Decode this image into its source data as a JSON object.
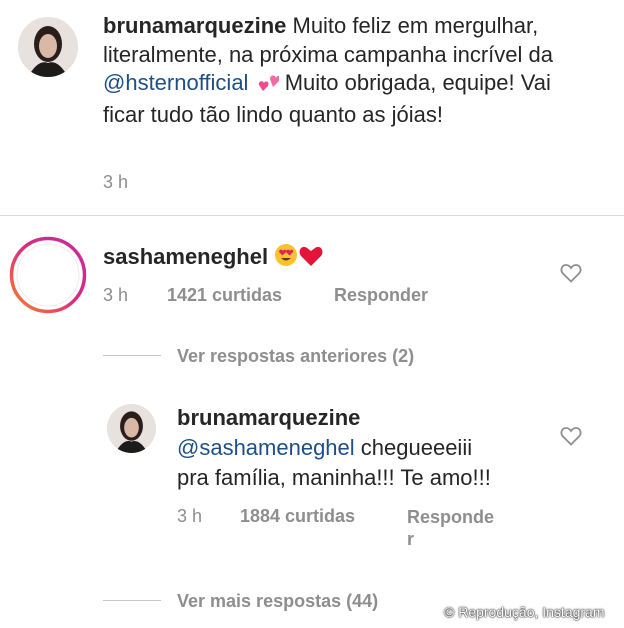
{
  "post": {
    "username": "brunamarquezine",
    "caption_text_1": " Muito feliz em mergulhar, literalmente, na próxima campanha incrível da ",
    "mention": "@hsternofficial",
    "caption_text_2": " Muito obrigada, equipe! Vai ficar tudo tão lindo quanto as jóias!",
    "time": "3 h"
  },
  "comment": {
    "username": "sashameneghel",
    "time": "3 h",
    "likes": "1421 curtidas",
    "reply_label": "Responder",
    "view_previous": "Ver respostas anteriores (2)"
  },
  "reply": {
    "username": "brunamarquezine",
    "mention": "@sashameneghel",
    "text_1": " chegueeeiii",
    "text_2": "pra família, maninha!!! Te amo!!!",
    "time": "3 h",
    "likes": "1884 curtidas",
    "reply_label_1": "Responde",
    "reply_label_2": "r"
  },
  "more_replies": "Ver mais respostas (44)",
  "credit": "© Reprodução, Instagram",
  "colors": {
    "text": "#262626",
    "muted": "#8e8e8e",
    "mention": "#1e4f86",
    "story_ring_start": "#f58529",
    "story_ring_end": "#dd2a7b"
  },
  "icons": [
    "heart-outline-icon",
    "heart-emoji-icon",
    "heart-eyes-emoji-icon",
    "two-hearts-emoji-icon"
  ]
}
